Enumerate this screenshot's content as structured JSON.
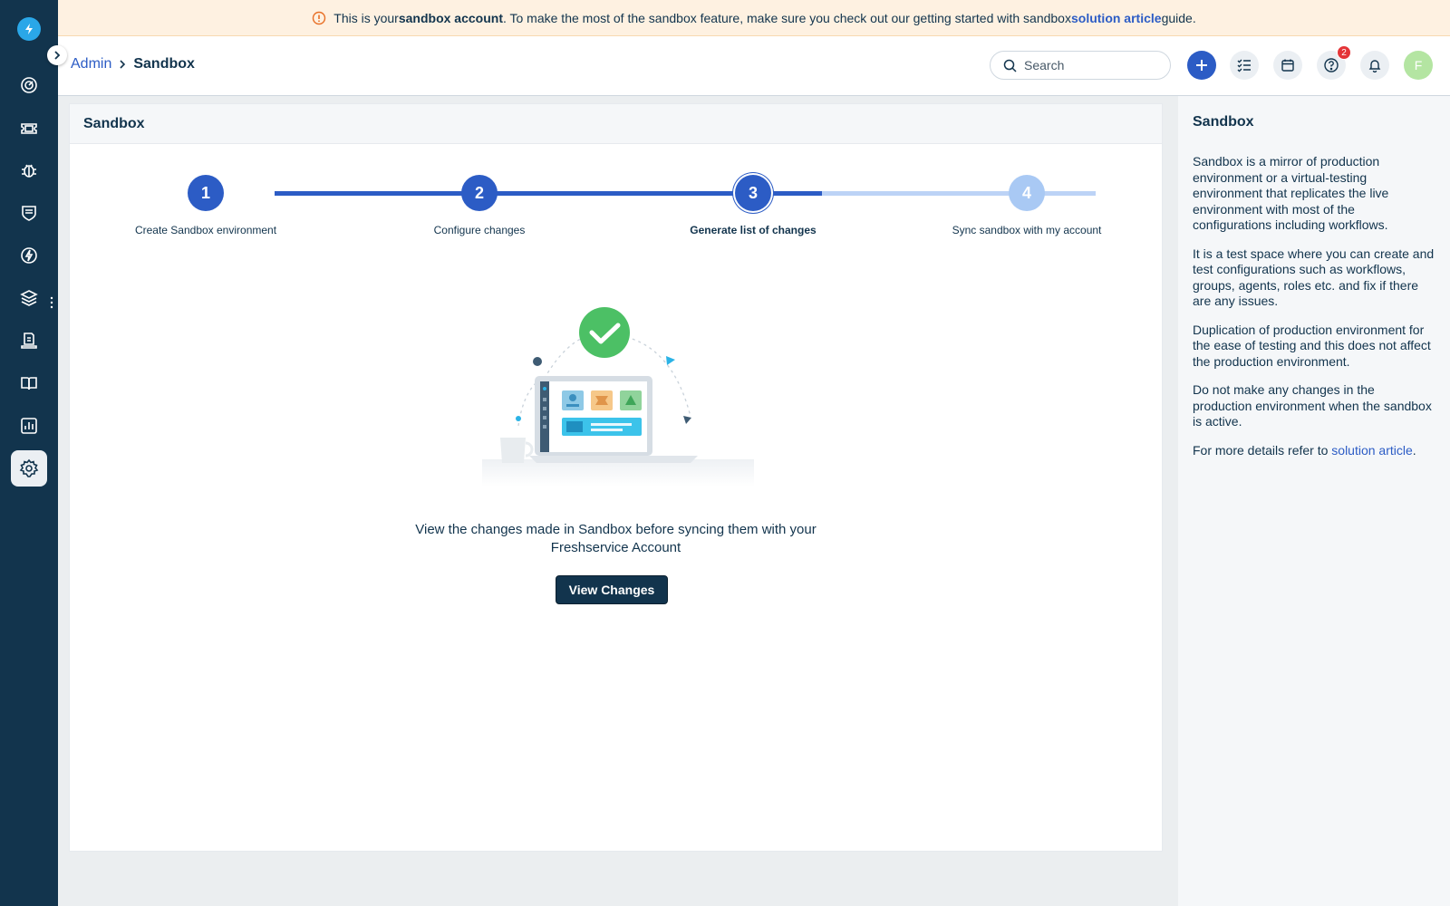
{
  "banner": {
    "text_before": "This is your ",
    "bold_text": "sandbox account",
    "text_middle": ". To make the most of the sandbox feature, make sure you check out our getting started with sandbox ",
    "link_text": "solution article",
    "text_after": " guide."
  },
  "nav": {
    "items": [
      "dashboard-icon",
      "tickets-icon",
      "problems-icon",
      "changes-icon",
      "releases-icon",
      "assets-icon",
      "projects-icon",
      "solutions-icon",
      "reports-icon",
      "admin-settings-icon"
    ],
    "active": "admin-settings-icon"
  },
  "breadcrumb": {
    "parent": "Admin",
    "current": "Sandbox"
  },
  "header": {
    "search_placeholder": "Search",
    "help_badge": "2",
    "avatar_initial": "F"
  },
  "card": {
    "title": "Sandbox",
    "steps": [
      {
        "number": "1",
        "label": "Create Sandbox environment",
        "state": "done"
      },
      {
        "number": "2",
        "label": "Configure changes",
        "state": "done"
      },
      {
        "number": "3",
        "label": "Generate list of changes",
        "state": "current"
      },
      {
        "number": "4",
        "label": "Sync sandbox with my account",
        "state": "pending"
      }
    ],
    "message": "View the changes made in Sandbox before syncing them with your Freshservice Account",
    "button_label": "View Changes"
  },
  "right_panel": {
    "title": "Sandbox",
    "para1": "Sandbox is a mirror of production environment or a virtual-testing environment that replicates the live environment with most of the configurations including workflows.",
    "para2": "It is a test space where you can create and test configurations such as workflows, groups, agents, roles etc. and fix if there are any issues.",
    "para3": "Duplication of production environment for the ease of testing and this does not affect the production environment.",
    "para4": "Do not make any changes in the production environment when the sandbox is active.",
    "para5_before": "For more details refer to ",
    "para5_link": "solution article",
    "para5_after": "."
  },
  "colors": {
    "nav_bg": "#12344d",
    "accent": "#2c5cc5",
    "banner_bg": "#fef1e1",
    "pending_step": "#a9c9f4"
  }
}
